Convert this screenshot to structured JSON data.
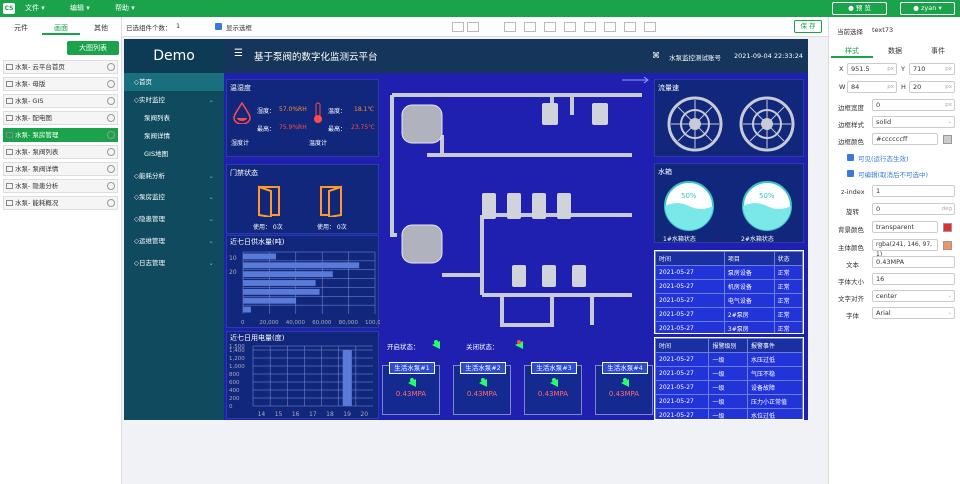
{
  "topbar": {
    "logo": "CS",
    "menus": [
      "文件 ▾",
      "编辑 ▾",
      "帮助 ▾"
    ],
    "preview_label": "预 览",
    "user_label": "zyan ▾"
  },
  "left": {
    "tabs": [
      "元件",
      "画面",
      "其他"
    ],
    "big_list_button": "大图列表",
    "pages": [
      {
        "label": "水泵- 云平台首页"
      },
      {
        "label": "水泵- 母版"
      },
      {
        "label": "水泵- GIS"
      },
      {
        "label": "水泵- 配电图"
      },
      {
        "label": "水泵- 泵房管理"
      },
      {
        "label": "水泵- 泵阀列表"
      },
      {
        "label": "水泵- 泵阀详情"
      },
      {
        "label": "水泵- 隐患分析"
      },
      {
        "label": "水泵- 能耗概况"
      }
    ]
  },
  "toolbar": {
    "selected_count_label": "已选组件个数：",
    "selected_count": "1",
    "show_box_label": "显示选框",
    "save_label": "保 存"
  },
  "canvas": {
    "demo": "Demo",
    "header_title": "基于泵阀的数字化监测云平台",
    "account": "水泵监控测试账号",
    "datetime": "2021-09-04 22:33:24",
    "nav": [
      {
        "label": "◇首页",
        "chevron": ""
      },
      {
        "label": "◇实时监控",
        "chevron": "⌄"
      },
      {
        "label": "泵阀列表",
        "chevron": ""
      },
      {
        "label": "泵阀详情",
        "chevron": ""
      },
      {
        "label": "GIS地图",
        "chevron": ""
      },
      {
        "label": "◇能耗分析",
        "chevron": "⌄"
      },
      {
        "label": "◇泵房监控",
        "chevron": "⌄"
      },
      {
        "label": "◇隐患管理",
        "chevron": "⌄"
      },
      {
        "label": "◇运维管理",
        "chevron": "⌄"
      },
      {
        "label": "◇日志管理",
        "chevron": "⌄"
      }
    ],
    "humidity": {
      "title": "温湿度",
      "hum_label": "湿度：",
      "hum_value": "57.0%RH",
      "temp_label": "温度：",
      "temp_value": "18.1℃",
      "hum_max_label": "最高：",
      "hum_max": "75.9%RH",
      "temp_max_label": "最高：",
      "temp_max": "23.75℃",
      "hum_meter": "湿度计",
      "temp_meter": "温度计"
    },
    "door": {
      "title": "门禁状态",
      "usage1": "使用：   0次",
      "usage2": "使用：   0次"
    },
    "pump_status": {
      "open_label": "开启状态：",
      "close_label": "关闭状态："
    },
    "pumps": [
      {
        "name": "生活水泵#1",
        "value": "0.43MPA"
      },
      {
        "name": "生活水泵#2",
        "value": "0.43MPA"
      },
      {
        "name": "生活水泵#3",
        "value": "0.43MPA"
      },
      {
        "name": "生活水泵#4",
        "value": "0.43MPA"
      }
    ],
    "flow": {
      "title": "流量速"
    },
    "tank": {
      "title": "水箱",
      "t1_pct": "50%",
      "t1_label": "1#水箱状态",
      "t2_pct": "50%",
      "t2_label": "2#水箱状态"
    },
    "status_table": {
      "headers": [
        "时间",
        "项目",
        "状态"
      ],
      "rows": [
        [
          "2021-05-27",
          "泵房设备",
          "正常"
        ],
        [
          "2021-05-27",
          "机房设备",
          "正常"
        ],
        [
          "2021-05-27",
          "电气设备",
          "正常"
        ],
        [
          "2021-05-27",
          "2#泵房",
          "正常"
        ],
        [
          "2021-05-27",
          "3#泵房",
          "正常"
        ]
      ]
    },
    "alarm_table": {
      "headers": [
        "时间",
        "报警级别",
        "报警事件"
      ],
      "rows": [
        [
          "2021-05-27",
          "一级",
          "水压过低"
        ],
        [
          "2021-05-27",
          "一级",
          "气压不稳"
        ],
        [
          "2021-05-27",
          "一级",
          "设备故障"
        ],
        [
          "2021-05-27",
          "一级",
          "压力小正常值"
        ],
        [
          "2021-05-27",
          "一级",
          "水位过低"
        ]
      ]
    }
  },
  "chart_data": [
    {
      "type": "bar",
      "orientation": "horizontal",
      "title": "近七日供水量(吨)",
      "categories": [
        "1",
        "2",
        "3",
        "4",
        "5",
        "6",
        "7"
      ],
      "values": [
        25000,
        88000,
        68000,
        55000,
        58000,
        40000,
        6000
      ],
      "x_ticks": [
        "0",
        "20,000",
        "40,000",
        "60,000",
        "80,000",
        "100,000"
      ],
      "y_ticks": [
        "10",
        "20"
      ],
      "xlim": [
        0,
        100000
      ],
      "grid": true,
      "color": "#5a7ad8"
    },
    {
      "type": "bar",
      "title": "近七日用电量(度)",
      "categories": [
        "14",
        "15",
        "16",
        "17",
        "18",
        "19",
        "20"
      ],
      "values": [
        0,
        0,
        0,
        0,
        0,
        1400,
        0
      ],
      "y_ticks": [
        "0",
        "200",
        "400",
        "600",
        "800",
        "1,000",
        "1,200",
        "1,400",
        "1,500"
      ],
      "ylim": [
        0,
        1500
      ],
      "grid": true,
      "color": "#5a7ad8"
    }
  ],
  "right": {
    "current_select_label": "当前选择",
    "current_select": "text73",
    "tabs": [
      "样式",
      "数据",
      "事件"
    ],
    "x_label": "X",
    "x": "951.5",
    "y_label": "Y",
    "y": "710",
    "w_label": "W",
    "w": "84",
    "h_label": "H",
    "h": "20",
    "unit_px": "px",
    "border_width_label": "边框宽度",
    "border_width": "0",
    "border_style_label": "边框样式",
    "border_style": "solid",
    "border_color_label": "边框颜色",
    "border_color": "#ccccccff",
    "visible_label": "可见(运行态生效)",
    "clickable_label": "可编辑(取消后不可选中)",
    "zindex_label": "z-index",
    "zindex": "1",
    "rotate_label": "旋转",
    "rotate": "0",
    "unit_deg": "deg",
    "bg_color_label": "背景颜色",
    "bg_color": "transparent",
    "main_color_label": "主体颜色",
    "main_color": "rgba(241, 146, 97, 1)",
    "text_label": "文本",
    "text": "0.43MPA",
    "font_size_label": "字体大小",
    "font_size": "16",
    "align_label": "文字对齐",
    "align": "center",
    "font_label": "字体",
    "font": "Arial"
  }
}
